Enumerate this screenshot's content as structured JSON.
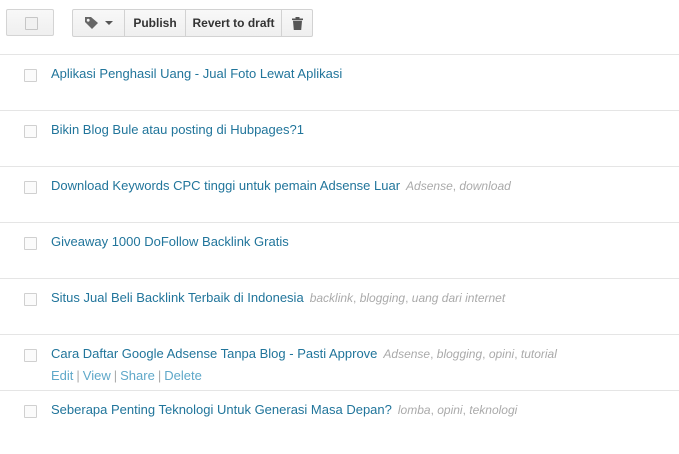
{
  "toolbar": {
    "publish_label": "Publish",
    "revert_label": "Revert to draft",
    "label_icon": "tag-icon",
    "delete_icon": "trash-icon"
  },
  "posts": [
    {
      "title": "Aplikasi Penghasil Uang - Jual Foto Lewat Aplikasi",
      "labels": [],
      "actions": []
    },
    {
      "title": "Bikin Blog Bule atau posting di Hubpages?1",
      "labels": [],
      "actions": []
    },
    {
      "title": "Download Keywords CPC tinggi untuk pemain Adsense Luar",
      "labels": [
        "Adsense",
        "download"
      ],
      "actions": []
    },
    {
      "title": "Giveaway 1000 DoFollow Backlink Gratis",
      "labels": [],
      "actions": []
    },
    {
      "title": "Situs Jual Beli Backlink Terbaik di Indonesia",
      "labels": [
        "backlink",
        "blogging",
        "uang dari internet"
      ],
      "actions": []
    },
    {
      "title": "Cara Daftar Google Adsense Tanpa Blog - Pasti Approve",
      "labels": [
        "Adsense",
        "blogging",
        "opini",
        "tutorial"
      ],
      "actions": [
        "Edit",
        "View",
        "Share",
        "Delete"
      ]
    },
    {
      "title": "Seberapa Penting Teknologi Untuk Generasi Masa Depan?",
      "labels": [
        "lomba",
        "opini",
        "teknologi"
      ],
      "actions": []
    }
  ],
  "colors": {
    "title_link": "#21759b",
    "label_text": "#aaaaaa",
    "action_link": "#5fa8c9",
    "divider": "#e5e5e5"
  }
}
